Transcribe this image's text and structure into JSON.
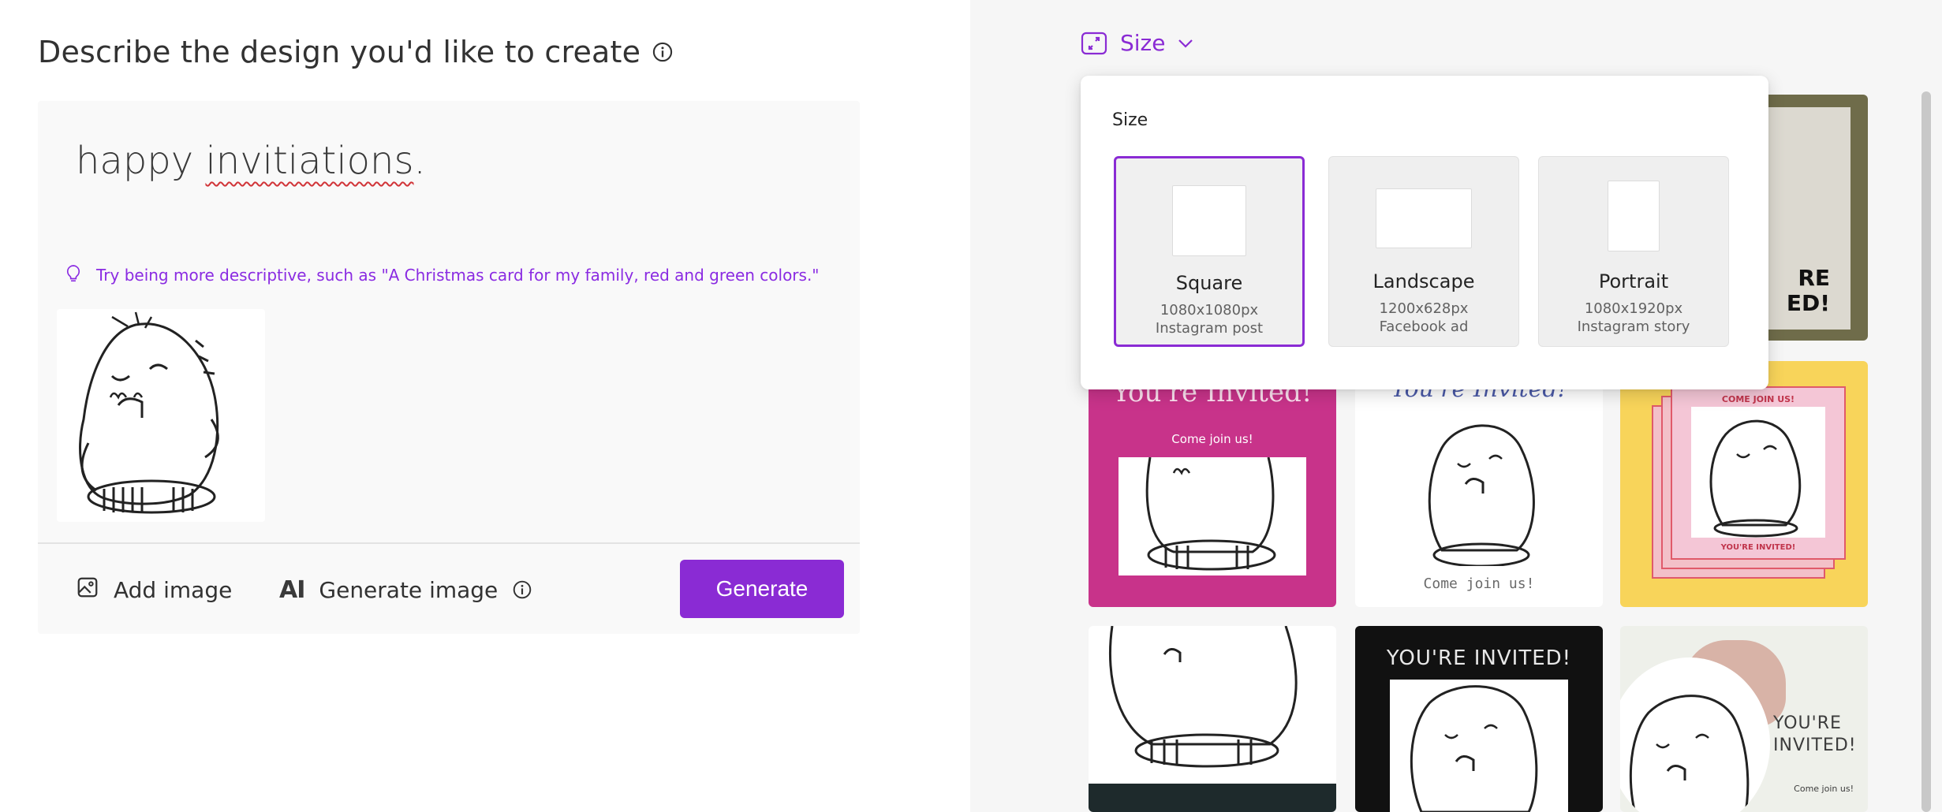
{
  "left": {
    "heading": "Describe the design you'd like to create",
    "prompt": {
      "before": "happy ",
      "misspelled": "invitiations",
      "after": "."
    },
    "tip": "Try being more descriptive, such as \"A Christmas card for my family, red and green colors.\"",
    "actions": {
      "add_image": "Add image",
      "generate_image": "Generate image",
      "generate": "Generate"
    }
  },
  "right": {
    "size_toggle": "Size",
    "size_panel": {
      "title": "Size",
      "options": [
        {
          "name": "Square",
          "dimensions": "1080x1080px",
          "use": "Instagram post",
          "selected": true
        },
        {
          "name": "Landscape",
          "dimensions": "1200x628px",
          "use": "Facebook ad",
          "selected": false
        },
        {
          "name": "Portrait",
          "dimensions": "1080x1920px",
          "use": "Instagram story",
          "selected": false
        }
      ]
    },
    "designs": {
      "r0c2_text_a": "RE",
      "r0c2_text_b": "ED!",
      "pink_title": "You're Invited!",
      "pink_sub": "Come join us!",
      "white_title": "You're Invited!",
      "white_sub": "Come join us!",
      "yellow_top": "COME JOIN US!",
      "yellow_bottom": "YOU'RE INVITED!",
      "black_title": "YOU'RE INVITED!",
      "green_title": "YOU'RE INVITED!",
      "green_sub": "Come join us!"
    }
  },
  "colors": {
    "accent": "#8a2bd4",
    "tip_text": "#8a2be2",
    "pink_tile": "#c8338a",
    "yellow_tile": "#f8d45a",
    "olive_tile": "#6f6c4a"
  },
  "icons": [
    "info-icon",
    "lightbulb-icon",
    "image-icon",
    "ai-icon",
    "resize-icon",
    "chevron-down-icon"
  ]
}
